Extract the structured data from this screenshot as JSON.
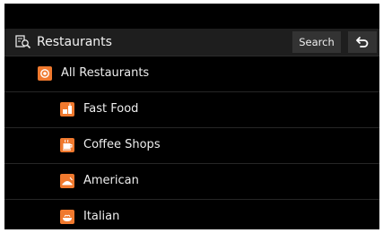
{
  "header": {
    "title": "Restaurants",
    "search_label": "Search",
    "title_icon": "restaurant-search-icon",
    "back_icon": "back-arrow-icon"
  },
  "list": {
    "items": [
      {
        "label": "All Restaurants",
        "icon": "plate-icon",
        "level": 0
      },
      {
        "label": "Fast Food",
        "icon": "fast-food-icon",
        "level": 1
      },
      {
        "label": "Coffee Shops",
        "icon": "coffee-cup-icon",
        "level": 1
      },
      {
        "label": "American",
        "icon": "american-cuisine-icon",
        "level": 1
      },
      {
        "label": "Italian",
        "icon": "italian-cuisine-icon",
        "level": 1
      }
    ]
  },
  "colors": {
    "background": "#000000",
    "header_bar": "#1e1e1e",
    "button": "#333333",
    "accent": "#f0792e",
    "text": "#eeeeee"
  }
}
